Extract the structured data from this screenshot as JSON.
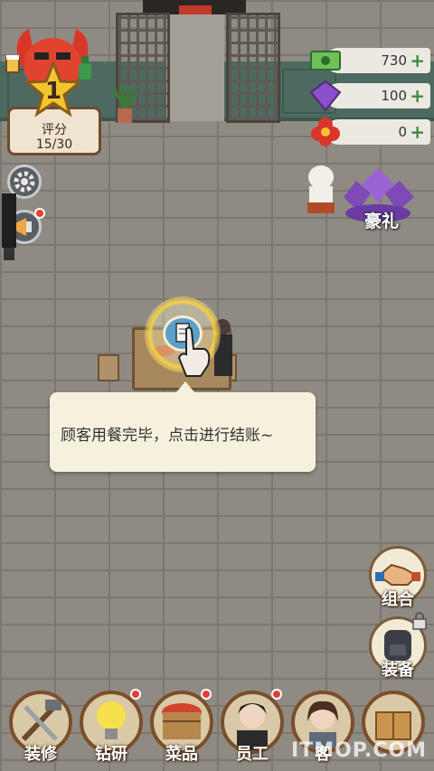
{
  "rating": {
    "level": "1",
    "label": "评分",
    "value": "15/30"
  },
  "currencies": [
    {
      "name": "cash",
      "value": "730"
    },
    {
      "name": "gem",
      "value": "100"
    },
    {
      "name": "flower",
      "value": "0"
    }
  ],
  "gift": {
    "label": "豪礼"
  },
  "tooltip": {
    "text": "顾客用餐完毕，点击进行结账~"
  },
  "side_buttons": {
    "combo": "组合",
    "equip": "装备"
  },
  "bottom_nav": [
    {
      "label": "装修"
    },
    {
      "label": "钻研"
    },
    {
      "label": "菜品"
    },
    {
      "label": "员工"
    },
    {
      "label": "客"
    },
    {
      "label": ""
    }
  ],
  "watermark": "ITMOP.COM",
  "colors": {
    "accent_red": "#e24036",
    "wall": "#4d6a61",
    "panel": "#f6f1dd"
  }
}
